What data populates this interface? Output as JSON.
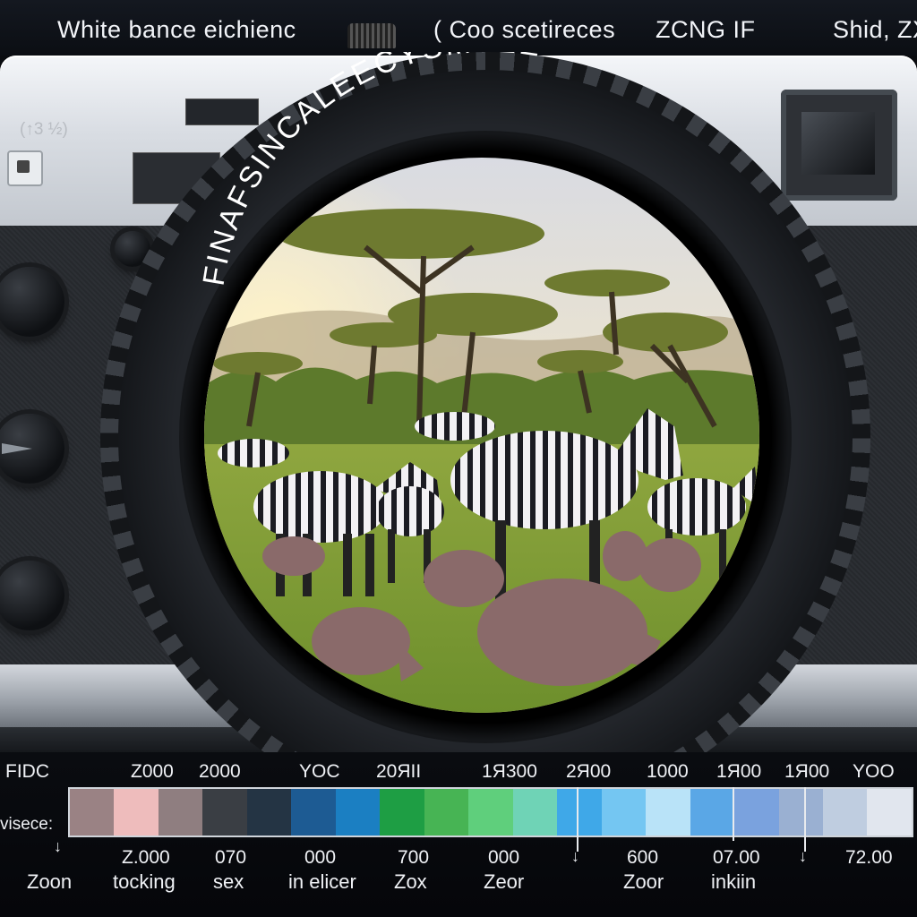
{
  "top": {
    "left": "White bance eichienc",
    "middle": "( Coo scetireces",
    "right1": "ZCNG IF",
    "right2": "Shid, ZX"
  },
  "camera": {
    "faint_label": "(↑3 ½)",
    "lens_text": "FINAFSINCALEECYSMTEE"
  },
  "scale": {
    "top_ticks": [
      "FIDC",
      "Z000",
      "2000",
      "YOC",
      "20ЯII",
      "1Я300",
      "2Я00",
      "1000",
      "1Я00",
      "1Я00",
      "YOO"
    ],
    "side_label": "visece:",
    "bottom_numbers": [
      "Z.000",
      "070",
      "000",
      "700",
      "000",
      "600",
      "07.00",
      "72.00"
    ],
    "bottom_words": [
      "Zoon",
      "tocking",
      "sex",
      "in elicer",
      "Zox",
      "Zeor",
      "Zoor",
      "inkiin"
    ],
    "segment_colors": [
      "#9a8284",
      "#eebcbc",
      "#8f7e80",
      "#3a3e44",
      "#243444",
      "#1d5b93",
      "#1b7fc2",
      "#1e9e44",
      "#47b454",
      "#5fcf7c",
      "#6fd3b6",
      "#3fa8e8",
      "#74c6f2",
      "#b9e3f8",
      "#5aa7e6",
      "#7aa2de",
      "#9ab0d2",
      "#bfcde0",
      "#e1e6ee"
    ]
  }
}
